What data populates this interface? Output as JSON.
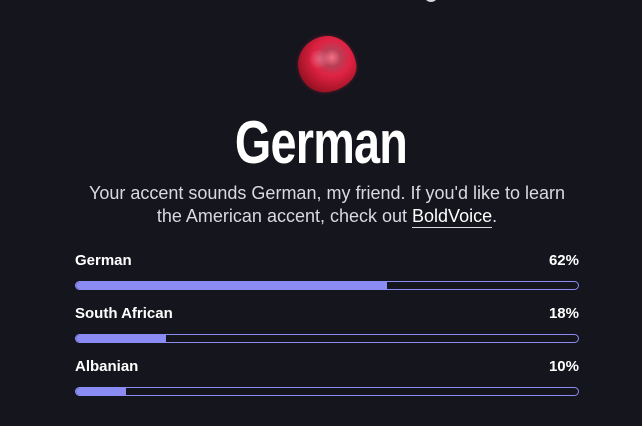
{
  "accent": {
    "title": "German",
    "description_before": "Your accent sounds German, my friend. If you'd like to learn the American accent, check out ",
    "link_text": "BoldVoice",
    "description_after": "."
  },
  "results": [
    {
      "label": "German",
      "percent_text": "62%",
      "fraction": 0.62
    },
    {
      "label": "South African",
      "percent_text": "18%",
      "fraction": 0.18
    },
    {
      "label": "Albanian",
      "percent_text": "10%",
      "fraction": 0.1
    }
  ],
  "colors": {
    "background": "#15151d",
    "bar_accent": "#8a8cf4",
    "orb": "#e02a4f"
  },
  "icons": {
    "orb": "accent-orb-icon"
  }
}
